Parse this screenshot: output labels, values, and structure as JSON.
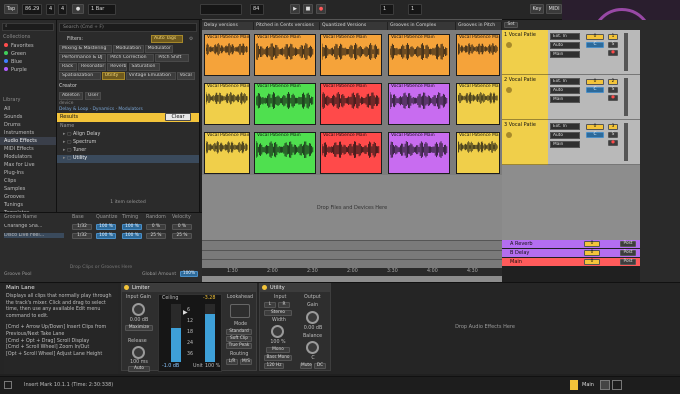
{
  "toolbar": {
    "tap": "Tap",
    "tempo": "86.29",
    "sig_num": "4",
    "sig_den": "4",
    "quantize": "1 Bar",
    "position": "84",
    "loop_start": "1",
    "loop_len": "1",
    "key": "Key",
    "midi": "MIDI"
  },
  "search": {
    "placeholder": "Search (Cmd + F)",
    "filters_label": "Filters:",
    "auto_tags": "Auto Tags"
  },
  "sidebar": {
    "collections_title": "Collections",
    "collections": [
      {
        "label": "Favorites",
        "color": "#ff4d4d"
      },
      {
        "label": "Green",
        "color": "#3fcf5a"
      },
      {
        "label": "Blue",
        "color": "#3f7fff"
      },
      {
        "label": "Purple",
        "color": "#b35cff"
      }
    ],
    "library_title": "Library",
    "library": [
      "All",
      "Sounds",
      "Drums",
      "Instruments",
      "Audio Effects",
      "MIDI Effects",
      "Modulators",
      "Max for Live",
      "Plug-Ins",
      "Clips",
      "Samples",
      "Grooves",
      "Tunings",
      "Templates"
    ],
    "selected_index": 4
  },
  "browser": {
    "tags": [
      [
        "Mixing & Mastering",
        "Modulation",
        "Modulator"
      ],
      [
        "Performance & DJ",
        "Pitch Correction",
        "Pitch Shift"
      ],
      [
        "Rack",
        "Resonator",
        "Reverb",
        "Saturation"
      ],
      [
        "Spatialization",
        "Utility",
        "Vintage Emulation",
        "Vocal"
      ]
    ],
    "creator_label": "Creator",
    "creators": [
      "Ableton",
      "User"
    ],
    "links": [
      "Delay & Loop",
      "Dynamics",
      "Modulators"
    ],
    "device_label": "device",
    "results_label": "Results",
    "clear_label": "Clear",
    "name_header": "Name",
    "results": [
      "Align Delay",
      "Spectrum",
      "Tuner",
      "Utility"
    ],
    "selected_status": "1 item selected"
  },
  "arrangement": {
    "columns": [
      "Delay versions",
      "Pitched in Cents versions",
      "Quantized Versions",
      "Grooves in Complex",
      "Grooves in Pitch"
    ],
    "clips": [
      {
        "label": "Vocal Patience Main",
        "color": "#f5a33a"
      },
      {
        "label": "Vocal Patience Main",
        "color": "#f5a33a"
      },
      {
        "label": "Vocal Patience Main",
        "color": "#f5a33a"
      },
      {
        "label": "Vocal Patience Main",
        "color": "#f5a33a"
      },
      {
        "label": "Vocal Patience Main",
        "color": "#f5a33a"
      },
      {
        "label": "Vocal Patience Main",
        "color": "#f0cf4a"
      },
      {
        "label": "Vocal Patience Main",
        "color": "#4fe04f"
      },
      {
        "label": "Vocal Patience Main",
        "color": "#ff4a4a"
      },
      {
        "label": "Vocal Patience Main",
        "color": "#c86cf0"
      },
      {
        "label": "Vocal Patience Main",
        "color": "#f0cf4a"
      },
      {
        "label": "Vocal Patience Main",
        "color": "#f0cf4a"
      },
      {
        "label": "Vocal Patience Main",
        "color": "#4fe04f"
      },
      {
        "label": "Vocal Patience Main",
        "color": "#ff4a4a"
      },
      {
        "label": "Vocal Patience Main",
        "color": "#c86cf0"
      },
      {
        "label": "Vocal Patience Main",
        "color": "#f0cf4a"
      }
    ],
    "drop_text": "Drop Files and Devices Here",
    "timeline": [
      "1:30",
      "2:00",
      "2:30",
      "2:00",
      "3:30",
      "4:00",
      "4:30"
    ]
  },
  "tracks": [
    {
      "name": "1 Vocal Patie",
      "num": "1"
    },
    {
      "name": "2 Vocal Patie",
      "num": "2"
    },
    {
      "name": "3 Vocal Patie",
      "num": "3"
    }
  ],
  "mixer": {
    "input": "Ext. In",
    "monitor": "Auto",
    "out": "Main",
    "vol": "0",
    "pan": "C"
  },
  "returns": [
    {
      "name": "A Reverb",
      "color": "#b46ef0"
    },
    {
      "name": "B Delay",
      "color": "#b46ef0"
    },
    {
      "name": "Main",
      "color": "#ff5b5b"
    }
  ],
  "grooves": {
    "headers": [
      "Groove Name",
      "Base",
      "Quantize",
      "Timing",
      "Random",
      "Velocity"
    ],
    "rows": [
      [
        "Charange Sha...",
        "1/32",
        "100 %",
        "100 %",
        "0 %",
        "0 %"
      ],
      [
        "Disco Live Feel...",
        "1/32",
        "100 %",
        "100 %",
        "25 %",
        "25 %"
      ]
    ],
    "drop_text": "Drop Clips or Grooves Here",
    "global_label": "Global Amount",
    "global_value": "100%",
    "pool_label": "Groove Pool"
  },
  "info": {
    "title": "Main Lane",
    "body": "Displays all clips that normally play through the track's mixer. Click and drag to select time, then use any available Edit menu command to edit.",
    "shortcuts": "[Cmd + Arrow Up/Down] Insert Clips from Previous/Next Take Lane\n[Cmd + Opt + Drag] Scroll Display\n[Cmd + Scroll Wheel] Zoom In/Out\n[Opt + Scroll Wheel] Adjust Lane Height"
  },
  "limiter": {
    "title": "Limiter",
    "input_gain_label": "Input Gain",
    "input_gain": "0.00 dB",
    "maximize": "Maximize",
    "ceiling_label": "Ceiling",
    "ceiling_value": "-1.0 dB",
    "lookahead_label": "Lookahead",
    "mode_label": "Mode",
    "modes": [
      "Standard",
      "Soft Clip",
      "True Peak"
    ],
    "release_label": "Release",
    "release_value": "100 ms",
    "auto": "Auto",
    "routing_label": "Routing",
    "routing": [
      "L/R",
      "M/S"
    ],
    "unit_label": "Unit",
    "unit_value": "100 %",
    "meter_top": "-3.28",
    "meter_vals": [
      "6",
      "12",
      "18",
      "24",
      "36"
    ]
  },
  "utility": {
    "title": "Utility",
    "input_label": "Input",
    "ch_l": "L",
    "ch_r": "R",
    "stereo": "Stereo",
    "width_label": "Width",
    "width_value": "100 %",
    "mono": "Mono",
    "bass_mono": "Bass Mono",
    "bass_freq": "120 Hz",
    "output_label": "Output",
    "gain_label": "Gain",
    "gain_value": "0.00 dB",
    "balance_label": "Balance",
    "balance_value": "C",
    "mute_label": "Mute",
    "dc_label": "DC"
  },
  "device_drop": "Drop Audio Effects Here",
  "status": {
    "text": "Insert Mark 10.1.1 (Time: 2:30:338)",
    "main": "Main"
  }
}
